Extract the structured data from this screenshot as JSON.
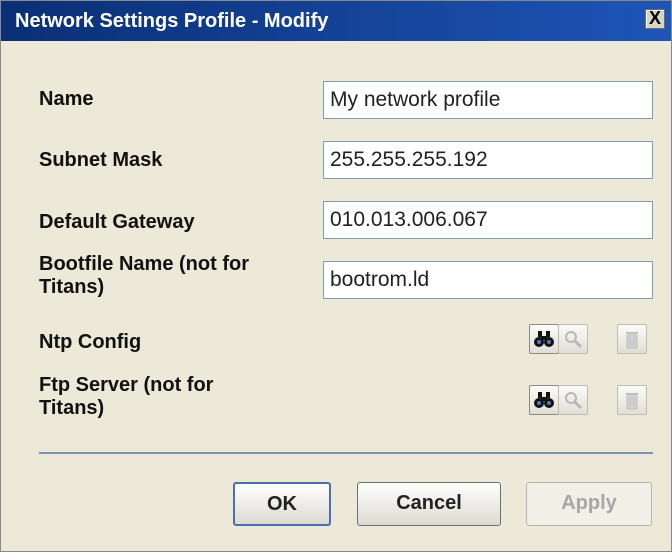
{
  "dialog": {
    "title": "Network Settings Profile - Modify",
    "close_label": "X"
  },
  "fields": {
    "name": {
      "label": "Name",
      "value": "My network profile"
    },
    "subnet_mask": {
      "label": "Subnet Mask",
      "value": "255.255.255.192"
    },
    "default_gateway": {
      "label": "Default Gateway",
      "value": "010.013.006.067"
    },
    "bootfile_name": {
      "label_line1": "Bootfile Name (not for",
      "label_line2": "Titans)",
      "value": "bootrom.ld"
    }
  },
  "lookups": {
    "ntp_config": {
      "label": "Ntp Config",
      "icons": [
        "binoculars-icon",
        "magnifier-icon",
        "trash-icon"
      ]
    },
    "ftp_server": {
      "label_line1": "Ftp Server (not for",
      "label_line2": "Titans)",
      "icons": [
        "binoculars-icon",
        "magnifier-icon",
        "trash-icon"
      ]
    }
  },
  "buttons": {
    "ok": "OK",
    "cancel": "Cancel",
    "apply": "Apply"
  },
  "colors": {
    "titlebar": "#0a2f75",
    "separator": "#7d94b6",
    "disabled_text": "#a6a6a6"
  }
}
